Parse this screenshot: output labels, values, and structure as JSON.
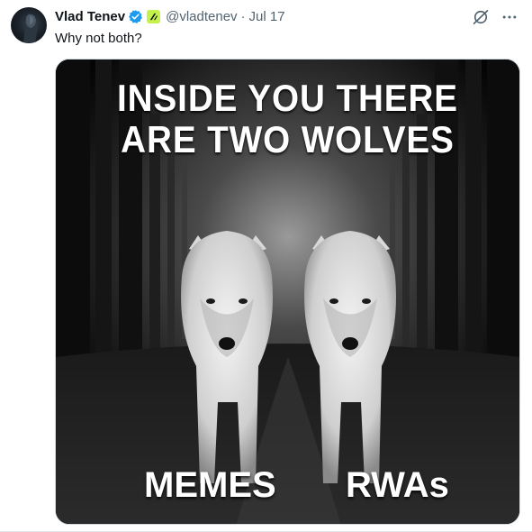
{
  "post": {
    "author_name": "Vlad Tenev",
    "handle": "@vladtenev",
    "separator": "·",
    "date": "Jul 17",
    "text": "Why not both?",
    "avatar": "avatar-dark-photo",
    "verified_icon": "verified-badge-icon",
    "affiliation_icon": "affiliation-badge-icon"
  },
  "actions": {
    "grok_icon": "grok-icon",
    "more_icon": "more-options-icon"
  },
  "media": {
    "title_line1": "INSIDE YOU THERE",
    "title_line2": "ARE TWO WOLVES",
    "caption_left": "MEMES",
    "caption_right": "RWAs",
    "description_icon": "wolves-meme-image"
  },
  "colors": {
    "verified_blue": "#1d9bf0",
    "affiliation_green": "#c4f24a",
    "secondary_text": "#536471"
  }
}
